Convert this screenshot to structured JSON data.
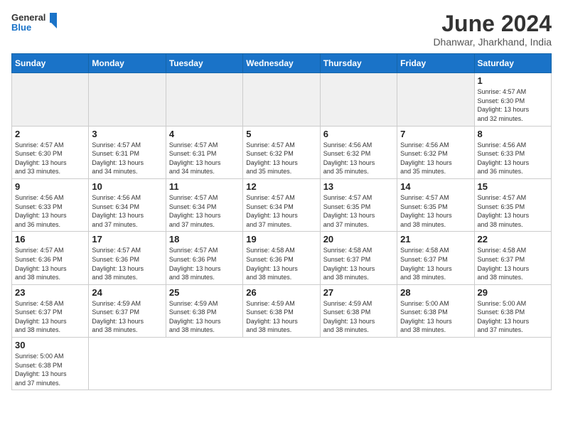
{
  "header": {
    "logo_general": "General",
    "logo_blue": "Blue",
    "month_title": "June 2024",
    "location": "Dhanwar, Jharkhand, India"
  },
  "weekdays": [
    "Sunday",
    "Monday",
    "Tuesday",
    "Wednesday",
    "Thursday",
    "Friday",
    "Saturday"
  ],
  "days": [
    {
      "date": "",
      "info": ""
    },
    {
      "date": "",
      "info": ""
    },
    {
      "date": "",
      "info": ""
    },
    {
      "date": "",
      "info": ""
    },
    {
      "date": "",
      "info": ""
    },
    {
      "date": "",
      "info": ""
    },
    {
      "date": "1",
      "info": "Sunrise: 4:57 AM\nSunset: 6:30 PM\nDaylight: 13 hours\nand 32 minutes."
    },
    {
      "date": "2",
      "info": "Sunrise: 4:57 AM\nSunset: 6:30 PM\nDaylight: 13 hours\nand 33 minutes."
    },
    {
      "date": "3",
      "info": "Sunrise: 4:57 AM\nSunset: 6:31 PM\nDaylight: 13 hours\nand 34 minutes."
    },
    {
      "date": "4",
      "info": "Sunrise: 4:57 AM\nSunset: 6:31 PM\nDaylight: 13 hours\nand 34 minutes."
    },
    {
      "date": "5",
      "info": "Sunrise: 4:57 AM\nSunset: 6:32 PM\nDaylight: 13 hours\nand 35 minutes."
    },
    {
      "date": "6",
      "info": "Sunrise: 4:56 AM\nSunset: 6:32 PM\nDaylight: 13 hours\nand 35 minutes."
    },
    {
      "date": "7",
      "info": "Sunrise: 4:56 AM\nSunset: 6:32 PM\nDaylight: 13 hours\nand 35 minutes."
    },
    {
      "date": "8",
      "info": "Sunrise: 4:56 AM\nSunset: 6:33 PM\nDaylight: 13 hours\nand 36 minutes."
    },
    {
      "date": "9",
      "info": "Sunrise: 4:56 AM\nSunset: 6:33 PM\nDaylight: 13 hours\nand 36 minutes."
    },
    {
      "date": "10",
      "info": "Sunrise: 4:56 AM\nSunset: 6:34 PM\nDaylight: 13 hours\nand 37 minutes."
    },
    {
      "date": "11",
      "info": "Sunrise: 4:57 AM\nSunset: 6:34 PM\nDaylight: 13 hours\nand 37 minutes."
    },
    {
      "date": "12",
      "info": "Sunrise: 4:57 AM\nSunset: 6:34 PM\nDaylight: 13 hours\nand 37 minutes."
    },
    {
      "date": "13",
      "info": "Sunrise: 4:57 AM\nSunset: 6:35 PM\nDaylight: 13 hours\nand 37 minutes."
    },
    {
      "date": "14",
      "info": "Sunrise: 4:57 AM\nSunset: 6:35 PM\nDaylight: 13 hours\nand 38 minutes."
    },
    {
      "date": "15",
      "info": "Sunrise: 4:57 AM\nSunset: 6:35 PM\nDaylight: 13 hours\nand 38 minutes."
    },
    {
      "date": "16",
      "info": "Sunrise: 4:57 AM\nSunset: 6:36 PM\nDaylight: 13 hours\nand 38 minutes."
    },
    {
      "date": "17",
      "info": "Sunrise: 4:57 AM\nSunset: 6:36 PM\nDaylight: 13 hours\nand 38 minutes."
    },
    {
      "date": "18",
      "info": "Sunrise: 4:57 AM\nSunset: 6:36 PM\nDaylight: 13 hours\nand 38 minutes."
    },
    {
      "date": "19",
      "info": "Sunrise: 4:58 AM\nSunset: 6:36 PM\nDaylight: 13 hours\nand 38 minutes."
    },
    {
      "date": "20",
      "info": "Sunrise: 4:58 AM\nSunset: 6:37 PM\nDaylight: 13 hours\nand 38 minutes."
    },
    {
      "date": "21",
      "info": "Sunrise: 4:58 AM\nSunset: 6:37 PM\nDaylight: 13 hours\nand 38 minutes."
    },
    {
      "date": "22",
      "info": "Sunrise: 4:58 AM\nSunset: 6:37 PM\nDaylight: 13 hours\nand 38 minutes."
    },
    {
      "date": "23",
      "info": "Sunrise: 4:58 AM\nSunset: 6:37 PM\nDaylight: 13 hours\nand 38 minutes."
    },
    {
      "date": "24",
      "info": "Sunrise: 4:59 AM\nSunset: 6:37 PM\nDaylight: 13 hours\nand 38 minutes."
    },
    {
      "date": "25",
      "info": "Sunrise: 4:59 AM\nSunset: 6:38 PM\nDaylight: 13 hours\nand 38 minutes."
    },
    {
      "date": "26",
      "info": "Sunrise: 4:59 AM\nSunset: 6:38 PM\nDaylight: 13 hours\nand 38 minutes."
    },
    {
      "date": "27",
      "info": "Sunrise: 4:59 AM\nSunset: 6:38 PM\nDaylight: 13 hours\nand 38 minutes."
    },
    {
      "date": "28",
      "info": "Sunrise: 5:00 AM\nSunset: 6:38 PM\nDaylight: 13 hours\nand 38 minutes."
    },
    {
      "date": "29",
      "info": "Sunrise: 5:00 AM\nSunset: 6:38 PM\nDaylight: 13 hours\nand 37 minutes."
    },
    {
      "date": "30",
      "info": "Sunrise: 5:00 AM\nSunset: 6:38 PM\nDaylight: 13 hours\nand 37 minutes."
    }
  ]
}
